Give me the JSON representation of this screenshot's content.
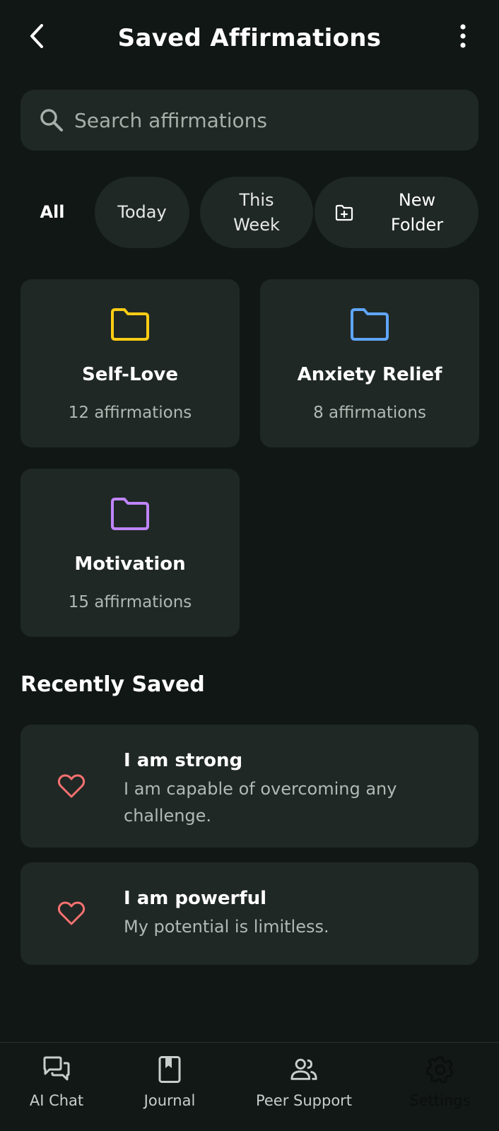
{
  "header": {
    "title": "Saved Affirmations",
    "back_icon": "chevron-left-icon",
    "more_icon": "more-vertical-icon"
  },
  "search": {
    "placeholder": "Search affirmations",
    "value": ""
  },
  "filters": {
    "all": "All",
    "today": "Today",
    "this_week": "This Week",
    "new_folder": "New Folder",
    "selected": "All"
  },
  "folders": [
    {
      "name": "Self-Love",
      "count": "12 affirmations",
      "color": "#FACC15"
    },
    {
      "name": "Anxiety Relief",
      "count": "8 affirmations",
      "color": "#60A5FA"
    },
    {
      "name": "Motivation",
      "count": "15 affirmations",
      "color": "#C084FC"
    }
  ],
  "recent": {
    "title": "Recently Saved",
    "items": [
      {
        "title": "I am strong",
        "text": "I am capable of overcoming any challenge."
      },
      {
        "title": "I am powerful",
        "text": "My potential is limitless."
      }
    ],
    "heart_color": "#F87171"
  },
  "nav": {
    "items": [
      {
        "label": "AI Chat",
        "icon": "chat-icon"
      },
      {
        "label": "Journal",
        "icon": "journal-icon"
      },
      {
        "label": "Peer Support",
        "icon": "people-icon"
      },
      {
        "label": "Settings",
        "icon": "gear-icon"
      }
    ]
  },
  "colors": {
    "background": "#111715",
    "surface": "#1F2824",
    "text_secondary": "#B2B8B5"
  }
}
